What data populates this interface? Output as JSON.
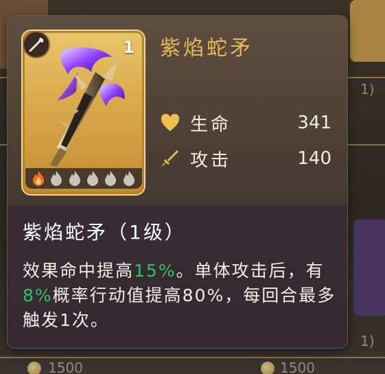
{
  "item": {
    "name": "紫焰蛇矛",
    "level": "1",
    "type_icon": "spear-type-icon",
    "stars_filled": 1,
    "stars_total": 6
  },
  "stats": [
    {
      "label": "生命",
      "value": "341",
      "icon": "heart-icon"
    },
    {
      "label": "攻击",
      "value": "140",
      "icon": "sword-icon"
    }
  ],
  "skill": {
    "title": "紫焰蛇矛（1级）",
    "desc_parts": [
      {
        "text": "效果命中提高",
        "hl": false
      },
      {
        "text": "15%",
        "hl": true
      },
      {
        "text": "。单体攻击后，有",
        "hl": false
      },
      {
        "text": "8%",
        "hl": true
      },
      {
        "text": "概率行动值提高80%，每回合最多触发1次。",
        "hl": false
      }
    ]
  },
  "background": {
    "fragments": [
      "1)",
      "1)",
      "1500",
      "1500"
    ]
  },
  "colors": {
    "title_gold": "#e8b85a",
    "highlight_green": "#2ec45f",
    "flame_active": "#ff6a2a",
    "flame_inactive": "#c9c3ba"
  }
}
